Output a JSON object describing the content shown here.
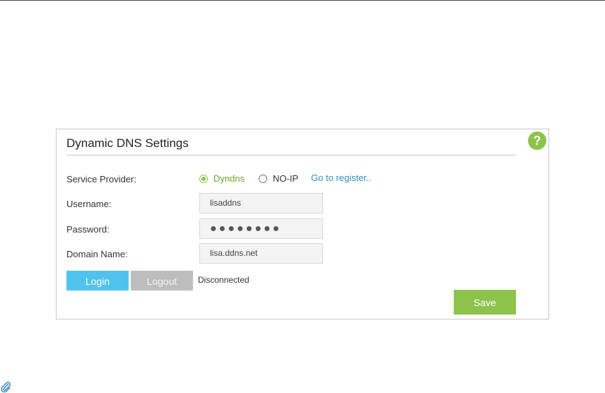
{
  "panel": {
    "title": "Dynamic DNS Settings",
    "help_icon": "question-mark-icon"
  },
  "form": {
    "service_provider_label": "Service Provider:",
    "providers": [
      {
        "label": "Dyndns",
        "selected": true
      },
      {
        "label": "NO-IP",
        "selected": false
      }
    ],
    "register_link": "Go to register..",
    "username_label": "Username:",
    "username_value": "lisaddns",
    "password_label": "Password:",
    "password_value": "●●●●●●●●",
    "domain_label": "Domain Name:",
    "domain_value": "lisa.ddns.net"
  },
  "actions": {
    "login_label": "Login",
    "logout_label": "Logout",
    "status": "Disconnected",
    "save_label": "Save"
  },
  "colors": {
    "accent_green": "#8cc34b",
    "login_blue": "#4fc3ee",
    "disabled_gray": "#bdbdbd",
    "link_blue": "#2a8fbd"
  },
  "icons": {
    "corner_icon": "paperclip-icon"
  }
}
